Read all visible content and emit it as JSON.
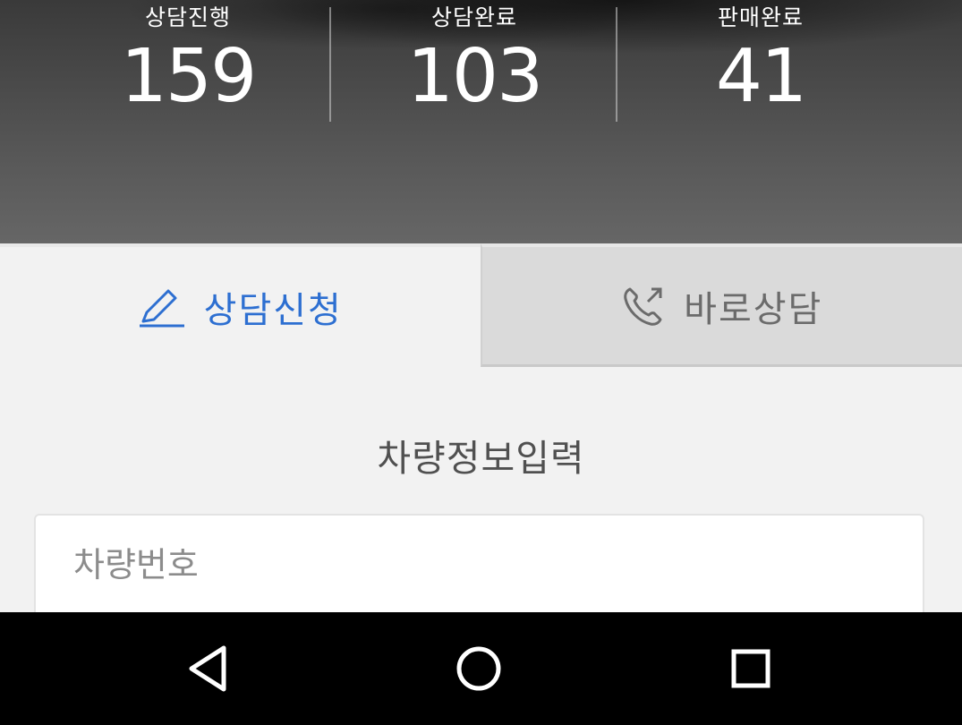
{
  "stats": [
    {
      "label": "상담진행",
      "value": "159"
    },
    {
      "label": "상담완료",
      "value": "103"
    },
    {
      "label": "판매완료",
      "value": "41"
    }
  ],
  "tabs": {
    "apply": {
      "label": "상담신청",
      "icon": "pencil-icon",
      "active": true
    },
    "direct": {
      "label": "바로상담",
      "icon": "phone-call-icon",
      "active": false
    }
  },
  "section": {
    "title": "차량정보입력"
  },
  "form": {
    "car_number_placeholder": "차량번호",
    "car_number_value": ""
  },
  "colors": {
    "accent": "#2d6fd1",
    "tab_inactive_bg": "#dadada",
    "navbar_bg": "#000000"
  },
  "navbar": {
    "back_icon": "back-triangle-icon",
    "home_icon": "home-circle-icon",
    "recent_icon": "recent-square-icon"
  }
}
